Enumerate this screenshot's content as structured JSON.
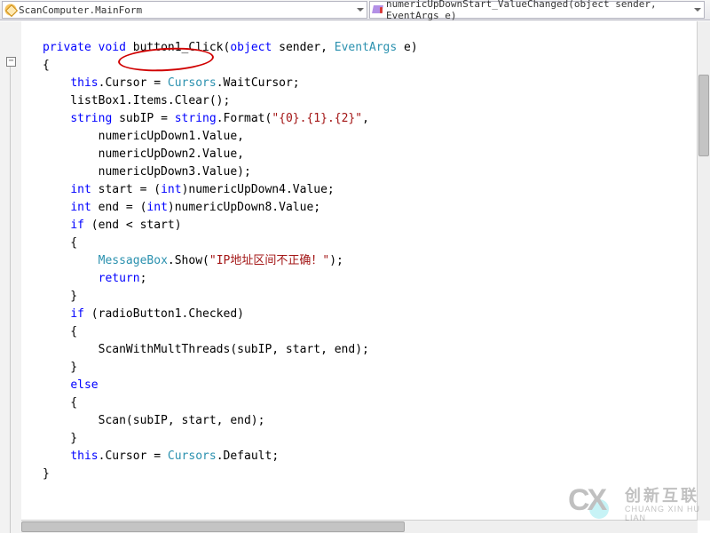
{
  "navbar": {
    "class_dd": "ScanComputer.MainForm",
    "method_dd": "numericUpDownStart_ValueChanged(object sender, EventArgs e)"
  },
  "collapse_glyph": "−",
  "code": {
    "l1_kw1": "private",
    "l1_kw2": "void",
    "l1_name": "button1_Click",
    "l1_open": "(",
    "l1_kw3": "object",
    "l1_p1": " sender, ",
    "l1_ty": "EventArgs",
    "l1_p2": " e)",
    "l2": "{",
    "l3_a": "    ",
    "l3_kw": "this",
    "l3_b": ".Cursor = ",
    "l3_ty": "Cursors",
    "l3_c": ".WaitCursor;",
    "l4": "    listBox1.Items.Clear();",
    "l5_a": "    ",
    "l5_kw": "string",
    "l5_b": " subIP = ",
    "l5_kw2": "string",
    "l5_c": ".Format(",
    "l5_str": "\"{0}.{1}.{2}\"",
    "l5_d": ",",
    "l6": "        numericUpDown1.Value,",
    "l7": "        numericUpDown2.Value,",
    "l8": "        numericUpDown3.Value);",
    "l9_a": "    ",
    "l9_kw": "int",
    "l9_b": " start = (",
    "l9_kw2": "int",
    "l9_c": ")numericUpDown4.Value;",
    "l10_a": "    ",
    "l10_kw": "int",
    "l10_b": " end = (",
    "l10_kw2": "int",
    "l10_c": ")numericUpDown8.Value;",
    "l11_a": "    ",
    "l11_kw": "if",
    "l11_b": " (end < start)",
    "l12": "    {",
    "l13_a": "        ",
    "l13_ty": "MessageBox",
    "l13_b": ".Show(",
    "l13_str": "\"IP地址区间不正确！\"",
    "l13_c": ");",
    "l14_a": "        ",
    "l14_kw": "return",
    "l14_b": ";",
    "l15": "    }",
    "l16_a": "    ",
    "l16_kw": "if",
    "l16_b": " (radioButton1.Checked)",
    "l17": "    {",
    "l18": "        ScanWithMultThreads(subIP, start, end);",
    "l19": "    }",
    "l20_a": "    ",
    "l20_kw": "else",
    "l21": "    {",
    "l22": "        Scan(subIP, start, end);",
    "l23": "    }",
    "l24_a": "    ",
    "l24_kw": "this",
    "l24_b": ".Cursor = ",
    "l24_ty": "Cursors",
    "l24_c": ".Default;",
    "l25": "}"
  },
  "annotation": {
    "circle_target": "button1_Click"
  },
  "watermark": {
    "logo": "CX",
    "cn": "创新互联",
    "py": "CHUANG XIN HU LIAN"
  }
}
